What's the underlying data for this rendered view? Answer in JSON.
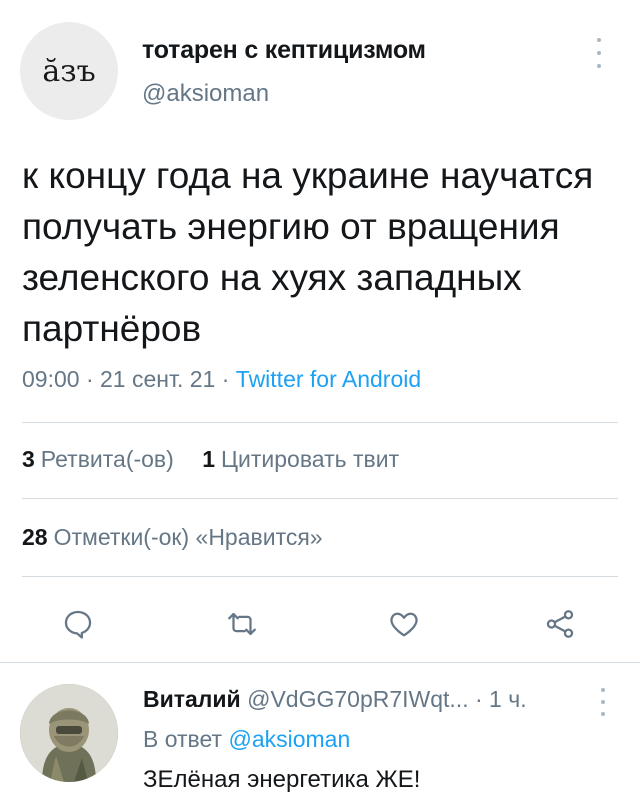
{
  "tweet": {
    "avatar_text": "ӑзъ",
    "display_name": "тотарен с кептицизмом",
    "handle": "@aksioman",
    "text": "к концу года на украине научатся получать энергию от вращения зеленского на хуях западных партнёров",
    "time": "09:00",
    "date": "21 сент. 21",
    "source": "Twitter for Android",
    "separator": "·"
  },
  "stats": {
    "retweets_count": "3",
    "retweets_label": "Ретвита(-ов)",
    "quotes_count": "1",
    "quotes_label": "Цитировать твит",
    "likes_count": "28",
    "likes_label": "Отметки(-ок) «Нравится»"
  },
  "actions": {
    "icons": [
      "reply-icon",
      "retweet-icon",
      "like-icon",
      "share-icon"
    ]
  },
  "reply": {
    "name": "Виталий",
    "handle": "@VdGG70pR7IWqt...",
    "separator": "·",
    "time": "1 ч.",
    "reply_prefix": "В ответ",
    "mention": "@aksioman",
    "text": "ЗЕлёная энергетика ЖЕ!"
  },
  "colors": {
    "accent": "#1da1f2",
    "secondary_text": "#657786",
    "divider": "#d5dce1"
  }
}
